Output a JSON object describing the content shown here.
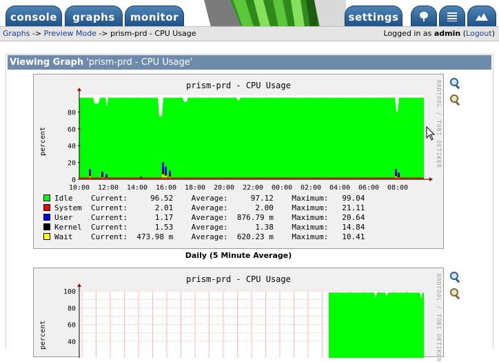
{
  "nav": {
    "tabs": [
      {
        "label": "console"
      },
      {
        "label": "graphs"
      },
      {
        "label": "monitor"
      }
    ],
    "settings_label": "settings",
    "icon_tabs": [
      "tree-view-icon",
      "list-view-icon",
      "preview-icon"
    ]
  },
  "breadcrumb": {
    "items": [
      "Graphs",
      "Preview Mode",
      "prism-prd - CPU Usage"
    ],
    "sep": " -> "
  },
  "login": {
    "prefix": "Logged in as",
    "user": "admin",
    "logout": "Logout"
  },
  "heading": {
    "bold": "Viewing Graph",
    "name": "'prism-prd - CPU Usage'"
  },
  "graphs": [
    {
      "title": "prism-prd - CPU Usage",
      "ylabel": "percent",
      "rrd_credit": "RRDTOOL / TOBI OETIKER",
      "caption": "Daily (5 Minute Average)",
      "yticks": [
        "0",
        "20",
        "40",
        "60",
        "80"
      ],
      "xticks": [
        "10:00",
        "12:00",
        "14:00",
        "16:00",
        "18:00",
        "20:00",
        "22:00",
        "00:00",
        "02:00",
        "04:00",
        "06:00",
        "08:00"
      ],
      "legend": [
        {
          "name": "Idle",
          "color": "#00ff00",
          "current": "96.52",
          "average": "97.12",
          "maximum": "99.04"
        },
        {
          "name": "System",
          "color": "#ee0000",
          "current": "2.01",
          "average": "2.00",
          "maximum": "21.11"
        },
        {
          "name": "User",
          "color": "#0000ee",
          "current": "1.17",
          "average": "876.79 m",
          "maximum": "20.64"
        },
        {
          "name": "Kernel",
          "color": "#000000",
          "current": "1.53",
          "average": "1.38",
          "maximum": "14.84"
        },
        {
          "name": "Wait",
          "color": "#ffff00",
          "current": "473.98 m",
          "average": "620.23 m",
          "maximum": "10.41"
        }
      ],
      "labels": {
        "current": "Current:",
        "average": "Average:",
        "maximum": "Maximum:"
      }
    },
    {
      "title": "prism-prd - CPU Usage",
      "ylabel": "percent",
      "rrd_credit": "RRDTOOL / TOBI OETIKER",
      "yticks": [
        "40",
        "60",
        "80",
        "100"
      ]
    }
  ],
  "colors": {
    "nav_tab": "#2a5f94",
    "heading_bar": "#6f8bab",
    "idle": "#00ff00",
    "grid": "#ff9999"
  },
  "icons": [
    "zoom-icon",
    "edit-graph-icon"
  ]
}
